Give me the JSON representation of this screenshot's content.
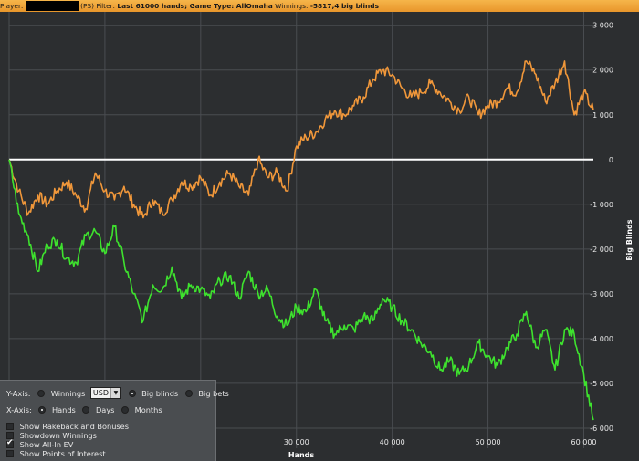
{
  "header": {
    "player_label": "Player:",
    "player_suffix": "(PS)",
    "filter_label": "Filter:",
    "filter_value": "Last 61000 hands; Game Type: AllOmaha",
    "winnings_label": "Winnings:",
    "winnings_value": "-5817,4 big blinds"
  },
  "chart_data": {
    "type": "line",
    "xlabel": "Hands",
    "ylabel": "Big Blinds",
    "xlim": [
      0,
      61000
    ],
    "ylim": [
      -6450,
      3300
    ],
    "x_ticks": [
      {
        "value": 30000,
        "label": "30 000"
      },
      {
        "value": 40000,
        "label": "40 000"
      },
      {
        "value": 50000,
        "label": "50 000"
      },
      {
        "value": 60000,
        "label": "60 000"
      }
    ],
    "y_ticks": [
      {
        "value": 3000,
        "label": "3 000"
      },
      {
        "value": 2000,
        "label": "2 000"
      },
      {
        "value": 1000,
        "label": "1 000"
      },
      {
        "value": 0,
        "label": "0"
      },
      {
        "value": -1000,
        "label": "-1 000"
      },
      {
        "value": -2000,
        "label": "-2 000"
      },
      {
        "value": -3000,
        "label": "-3 000"
      },
      {
        "value": -4000,
        "label": "-4 000"
      },
      {
        "value": -5000,
        "label": "-5 000"
      },
      {
        "value": -6000,
        "label": "-6 000"
      }
    ],
    "grid": true,
    "series": [
      {
        "key": "all_in_ev",
        "color": "#f0973a",
        "x": [
          0,
          1000,
          2000,
          3000,
          4000,
          5000,
          6000,
          7000,
          8000,
          9000,
          10000,
          11000,
          12000,
          13000,
          14000,
          15000,
          16000,
          17000,
          18000,
          19000,
          20000,
          21000,
          22000,
          23000,
          24000,
          25000,
          26000,
          27000,
          28000,
          29000,
          30000,
          31000,
          32000,
          33000,
          34000,
          35000,
          36000,
          37000,
          38000,
          39000,
          40000,
          41000,
          42000,
          43000,
          44000,
          45000,
          46000,
          47000,
          48000,
          49000,
          50000,
          51000,
          52000,
          53000,
          54000,
          55000,
          56000,
          57000,
          58000,
          59000,
          60000,
          61000
        ],
        "y": [
          0,
          -700,
          -1200,
          -800,
          -1000,
          -700,
          -500,
          -800,
          -1100,
          -300,
          -700,
          -900,
          -600,
          -1000,
          -1300,
          -900,
          -1200,
          -900,
          -500,
          -600,
          -400,
          -800,
          -500,
          -300,
          -600,
          -800,
          0,
          -400,
          -300,
          -700,
          300,
          500,
          600,
          900,
          1100,
          1000,
          1200,
          1400,
          1800,
          2000,
          1900,
          1600,
          1400,
          1500,
          1700,
          1500,
          1300,
          1100,
          1400,
          1000,
          1200,
          1300,
          1600,
          1500,
          2200,
          1900,
          1300,
          1700,
          2200,
          1000,
          1500,
          1100
        ]
      },
      {
        "key": "winnings",
        "color": "#3ee22e",
        "x": [
          0,
          1000,
          2000,
          3000,
          4000,
          5000,
          6000,
          7000,
          8000,
          9000,
          10000,
          11000,
          12000,
          13000,
          14000,
          15000,
          16000,
          17000,
          18000,
          19000,
          20000,
          21000,
          22000,
          23000,
          24000,
          25000,
          26000,
          27000,
          28000,
          29000,
          30000,
          31000,
          32000,
          33000,
          34000,
          35000,
          36000,
          37000,
          38000,
          39000,
          40000,
          41000,
          42000,
          43000,
          44000,
          45000,
          46000,
          47000,
          48000,
          49000,
          50000,
          51000,
          52000,
          53000,
          54000,
          55000,
          56000,
          57000,
          58000,
          59000,
          60000,
          61000
        ],
        "y": [
          0,
          -1200,
          -1700,
          -2500,
          -1900,
          -1800,
          -2200,
          -2300,
          -1700,
          -1600,
          -2100,
          -1500,
          -2300,
          -3000,
          -3600,
          -2800,
          -2900,
          -2400,
          -3100,
          -2800,
          -2900,
          -3100,
          -2700,
          -2600,
          -3100,
          -2500,
          -3000,
          -2900,
          -3500,
          -3700,
          -3300,
          -3400,
          -2900,
          -3600,
          -3900,
          -3700,
          -3800,
          -3500,
          -3600,
          -3100,
          -3300,
          -3600,
          -3800,
          -4100,
          -4300,
          -4700,
          -4500,
          -4800,
          -4600,
          -4100,
          -4400,
          -4600,
          -4200,
          -3900,
          -3400,
          -4200,
          -3800,
          -4700,
          -3800,
          -3900,
          -4800,
          -5817
        ]
      }
    ]
  },
  "options": {
    "y_axis_label": "Y-Axis:",
    "y_winnings": "Winnings",
    "currency": "USD",
    "y_big_blinds": "Big blinds",
    "y_big_bets": "Big bets",
    "x_axis_label": "X-Axis:",
    "x_hands": "Hands",
    "x_days": "Days",
    "x_months": "Months",
    "show_rakeback": "Show Rakeback and Bonuses",
    "showdown_winnings": "Showdown Winnings",
    "show_allin_ev": "Show All-In EV",
    "show_poi": "Show Points of Interest"
  }
}
